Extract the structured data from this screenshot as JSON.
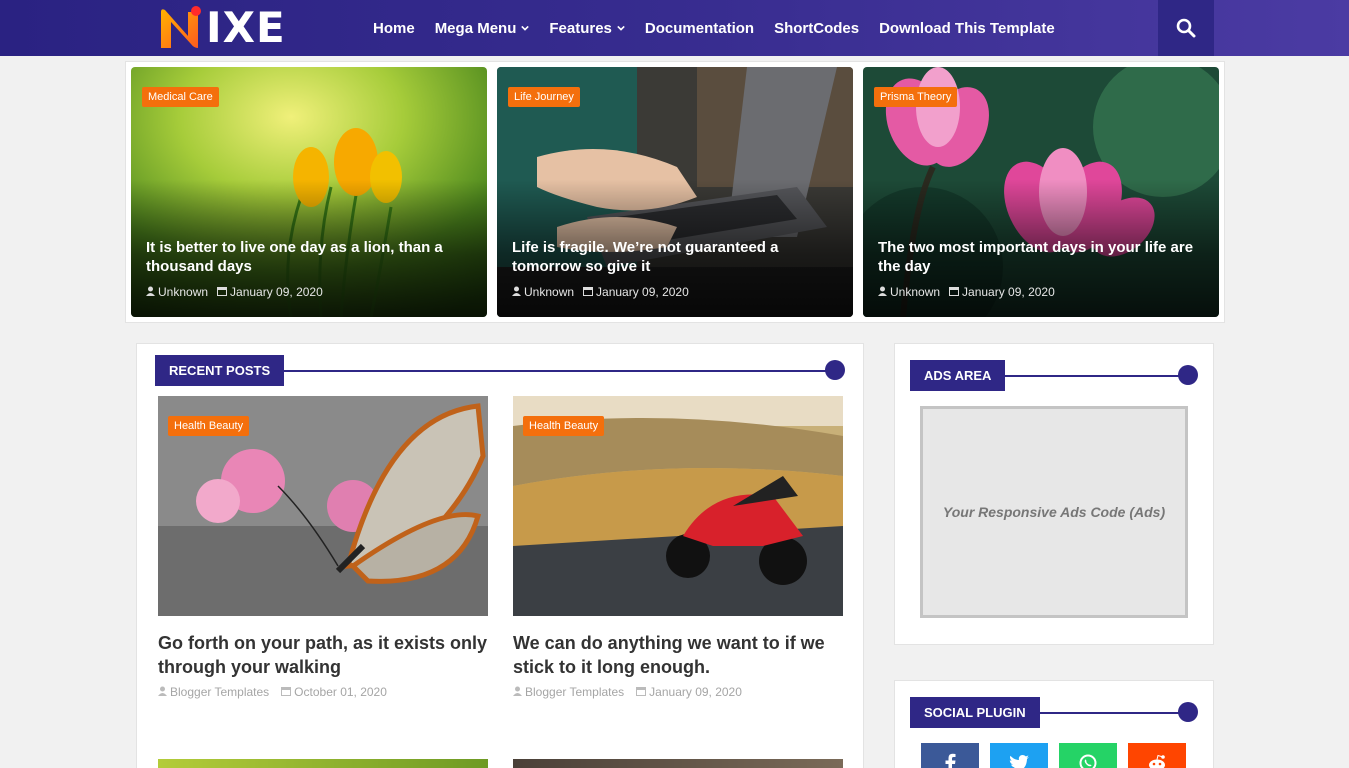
{
  "header": {
    "logo_text": "IXE",
    "nav": [
      {
        "label": "Home",
        "dropdown": false
      },
      {
        "label": "Mega Menu",
        "dropdown": true
      },
      {
        "label": "Features",
        "dropdown": true
      },
      {
        "label": "Documentation",
        "dropdown": false
      },
      {
        "label": "ShortCodes",
        "dropdown": false
      },
      {
        "label": "Download This Template",
        "dropdown": false
      }
    ],
    "search_icon": "search-icon"
  },
  "featured": [
    {
      "category": "Medical Care",
      "title": "It is better to live one day as a lion, than a thousand days",
      "author": "Unknown",
      "date": "January 09, 2020"
    },
    {
      "category": "Life Journey",
      "title": "Life is fragile. We’re not guaranteed a tomorrow so give it",
      "author": "Unknown",
      "date": "January 09, 2020"
    },
    {
      "category": "Prisma Theory",
      "title": "The two most important days in your life are the day",
      "author": "Unknown",
      "date": "January 09, 2020"
    }
  ],
  "recent": {
    "heading": "RECENT POSTS",
    "posts": [
      {
        "category": "Health Beauty",
        "title": "Go forth on your path, as it exists only through your walking",
        "author": "Blogger Templates",
        "date": "October 01, 2020"
      },
      {
        "category": "Health Beauty",
        "title": "We can do anything we want to if we stick to it long enough.",
        "author": "Blogger Templates",
        "date": "January 09, 2020"
      }
    ]
  },
  "ads": {
    "heading": "ADS AREA",
    "placeholder": "Your Responsive Ads Code (Ads)"
  },
  "social": {
    "heading": "SOCIAL PLUGIN",
    "buttons": [
      {
        "icon": "facebook-icon",
        "color": "#3b5998"
      },
      {
        "icon": "twitter-icon",
        "color": "#1da1f2"
      },
      {
        "icon": "whatsapp-icon",
        "color": "#25d366"
      },
      {
        "icon": "reddit-icon",
        "color": "#ff4500"
      }
    ]
  },
  "colors": {
    "primary": "#2f2786",
    "accent": "#f46f0c"
  }
}
